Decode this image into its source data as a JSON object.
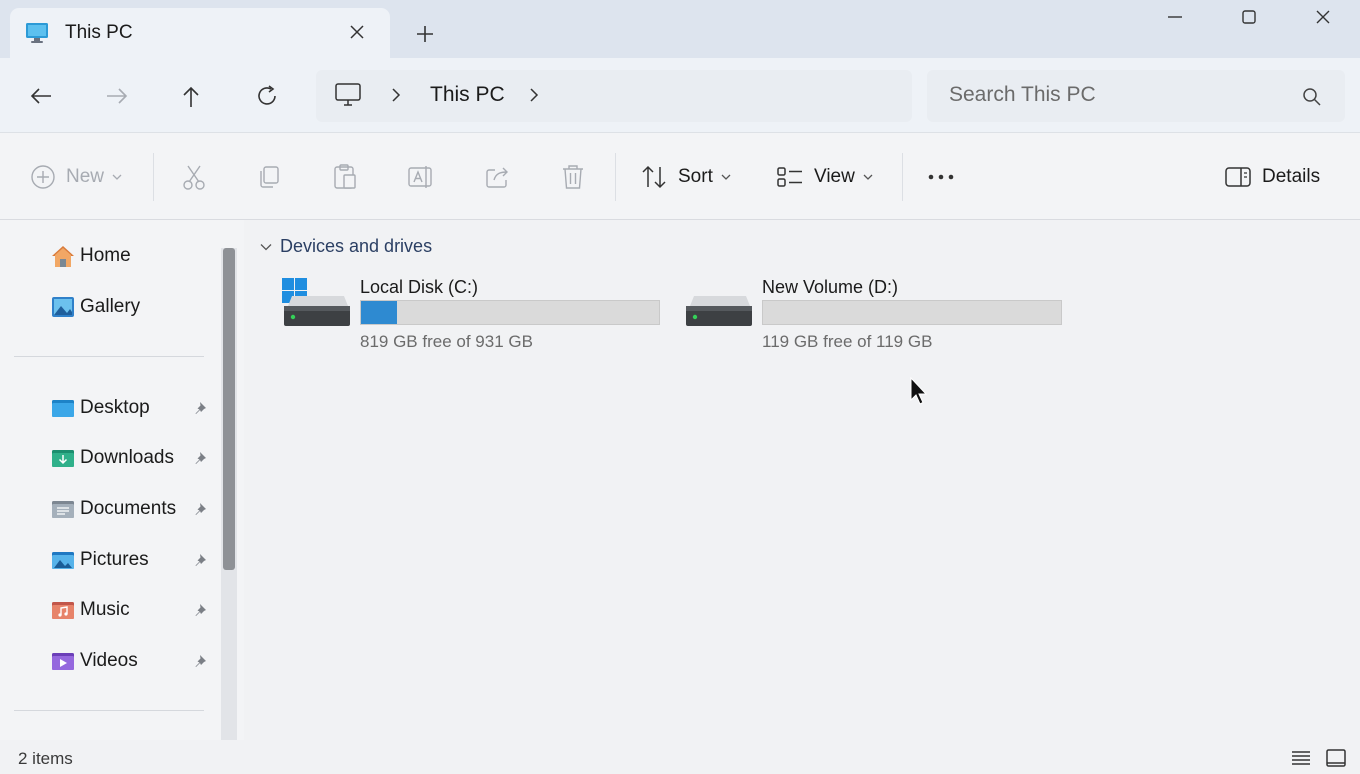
{
  "window": {
    "tab_title": "This PC",
    "tab_icon": "monitor-icon",
    "new_tab_icon": "plus-icon",
    "controls": [
      "minimize-icon",
      "maximize-icon",
      "close-icon"
    ]
  },
  "navigation": {
    "buttons": [
      "back-arrow-icon",
      "forward-arrow-icon",
      "up-arrow-icon",
      "refresh-icon"
    ],
    "breadcrumb": [
      "This PC"
    ],
    "search_placeholder": "Search This PC"
  },
  "toolbar": {
    "new_label": "New",
    "actions": [
      "cut-icon",
      "copy-icon",
      "paste-icon",
      "rename-icon",
      "share-icon",
      "delete-icon"
    ],
    "sort_label": "Sort",
    "view_label": "View",
    "more_icon": "more-icon",
    "details_label": "Details"
  },
  "sidebar": {
    "top": [
      {
        "label": "Home",
        "icon": "home-icon"
      },
      {
        "label": "Gallery",
        "icon": "gallery-icon"
      }
    ],
    "quick_access": [
      {
        "label": "Desktop",
        "icon": "desktop-folder-icon",
        "pinned": true
      },
      {
        "label": "Downloads",
        "icon": "downloads-folder-icon",
        "pinned": true
      },
      {
        "label": "Documents",
        "icon": "documents-folder-icon",
        "pinned": true
      },
      {
        "label": "Pictures",
        "icon": "pictures-folder-icon",
        "pinned": true
      },
      {
        "label": "Music",
        "icon": "music-folder-icon",
        "pinned": true
      },
      {
        "label": "Videos",
        "icon": "videos-folder-icon",
        "pinned": true
      }
    ]
  },
  "content": {
    "group_label": "Devices and drives",
    "drives": [
      {
        "name": "Local Disk (C:)",
        "free_text": "819 GB free of 931 GB",
        "used_fraction": 0.12,
        "system_drive": true
      },
      {
        "name": "New Volume (D:)",
        "free_text": "119 GB free of 119 GB",
        "used_fraction": 0.0,
        "system_drive": false
      }
    ]
  },
  "status": {
    "item_count": "2 items"
  },
  "colors": {
    "accent": "#2e8ad1",
    "titlebar": "#dde4ee",
    "toolbar": "#f3f4f6"
  }
}
